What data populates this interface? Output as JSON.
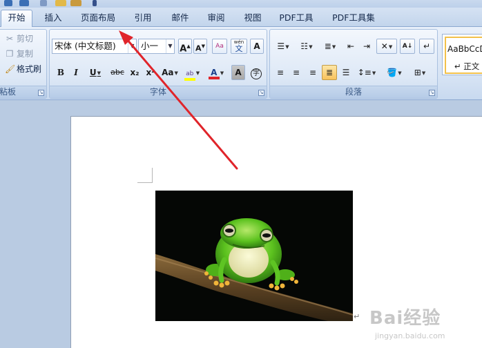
{
  "tabs": [
    "开始",
    "插入",
    "页面布局",
    "引用",
    "邮件",
    "审阅",
    "视图",
    "PDF工具",
    "PDF工具集"
  ],
  "clipboard": {
    "cut": "剪切",
    "copy": "复制",
    "format_painter": "格式刷",
    "group_label": "粘板"
  },
  "font": {
    "name": "宋体 (中文标题)",
    "size": "小一",
    "group_label": "字体",
    "grow_label": "A",
    "shrink_label": "A",
    "case_label": "Aa",
    "bold": "B",
    "italic": "I",
    "underline": "U",
    "strike": "abc",
    "subscript": "x₂",
    "superscript": "x²",
    "color_letter": "A",
    "shade_letter": "A",
    "wen_label": "wén",
    "wen_char": "文",
    "enclose_char": "字"
  },
  "paragraph": {
    "group_label": "段落"
  },
  "styles": {
    "sample": "AaBbCcD",
    "name": "↵ 正文"
  },
  "document": {
    "paragraph_mark": "↵"
  },
  "watermark": {
    "brand": "Bai经验",
    "url": "jingyan.baidu.com"
  },
  "colors": {
    "accent_red": "#e0242a",
    "highlight_yellow": "#ffff00",
    "frog_green": "#57c21f"
  }
}
